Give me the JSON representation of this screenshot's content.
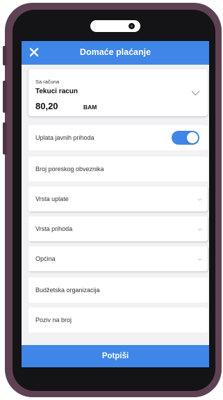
{
  "header": {
    "title": "Domaće plaćanje",
    "close_icon": "close-icon"
  },
  "account": {
    "label": "Sa računa",
    "name": "Tekuci racun",
    "balance": "80,20",
    "currency": "BAM",
    "chevron_icon": "chevron-down-icon"
  },
  "form": {
    "public_revenue_label": "Uplata javnih prihoda",
    "public_revenue_enabled": true,
    "taxpayer_number_label": "Broj poreskog obveznika",
    "payment_type_label": "Vrsta uplate",
    "revenue_type_label": "Vrsta prihoda",
    "municipality_label": "Općina",
    "budget_org_label": "Budžetska organizacija",
    "reference_number_label": "Poziv na broj"
  },
  "footer": {
    "submit_label": "Potpiši"
  },
  "colors": {
    "accent": "#3f86e8",
    "phone_frame": "#5e4253",
    "screen_bg": "#f2f2f4"
  }
}
